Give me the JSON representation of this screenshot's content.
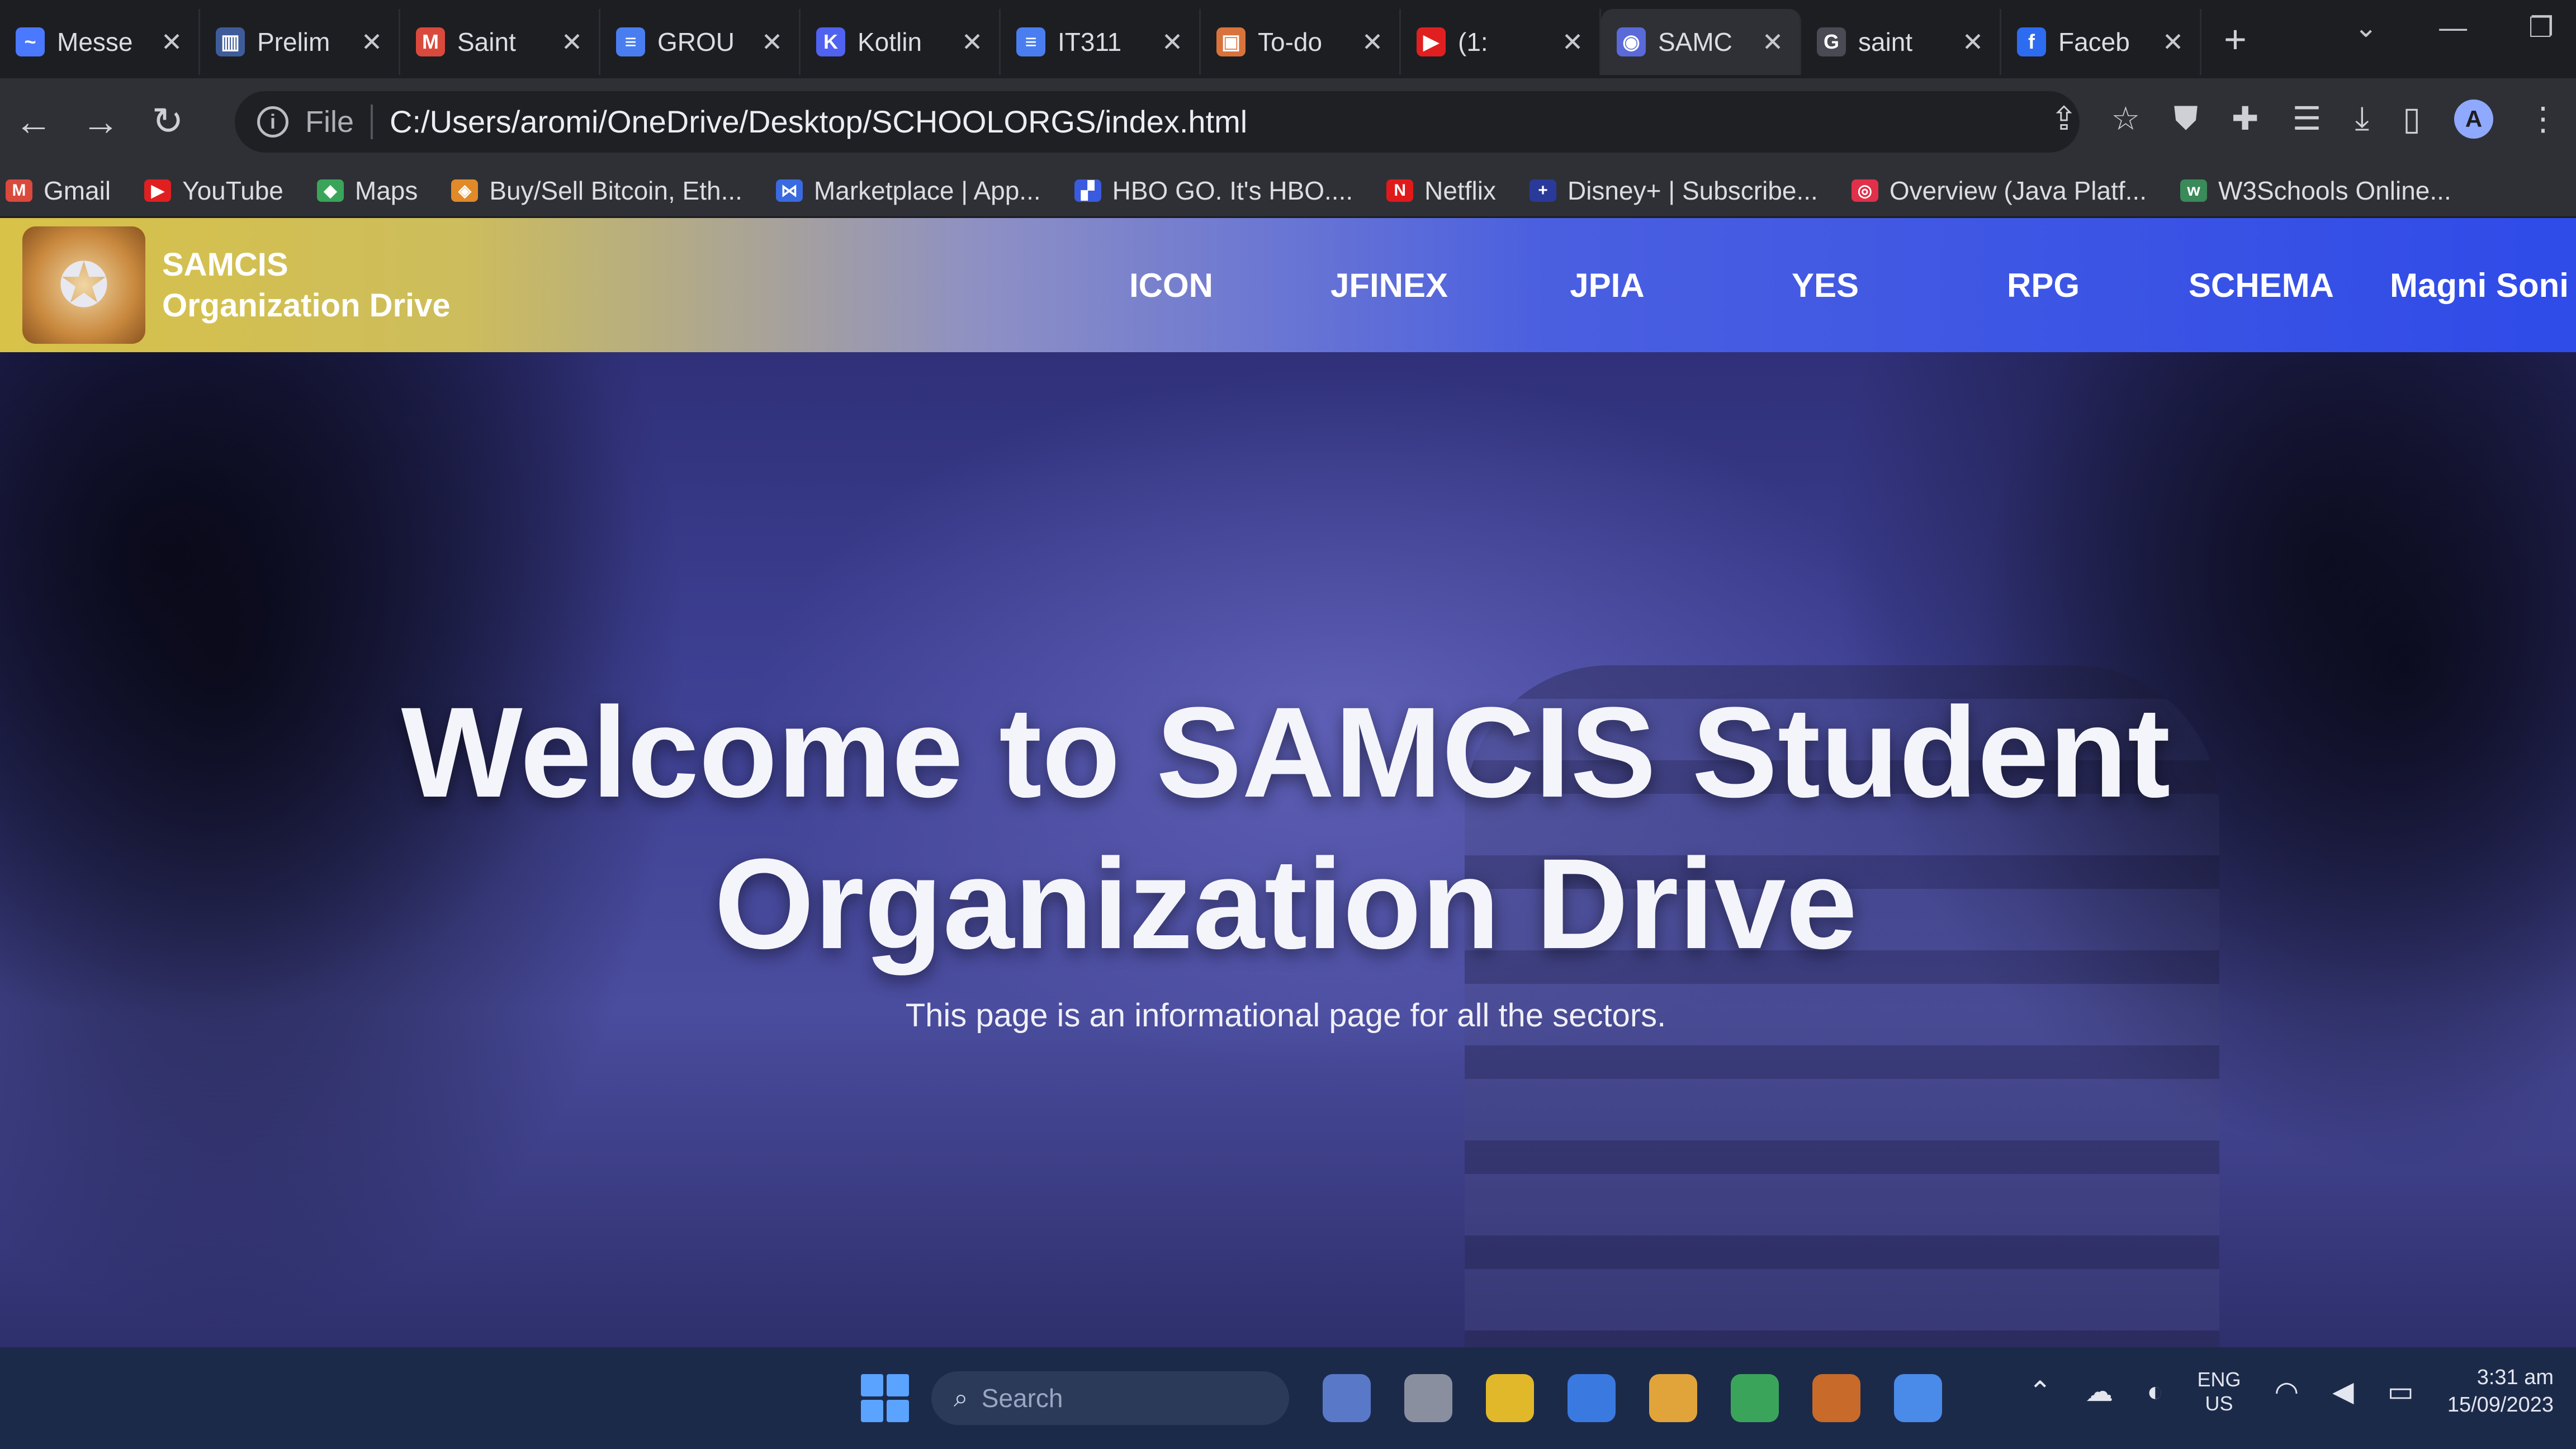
{
  "tabs": [
    {
      "title": "Messe",
      "icon": "messenger-icon",
      "color": "#4a78ff",
      "glyph": "~"
    },
    {
      "title": "Prelim",
      "icon": "trello-icon",
      "color": "#3f5c9a",
      "glyph": "▥"
    },
    {
      "title": "Saint",
      "icon": "gmail-icon",
      "color": "#d94a3c",
      "glyph": "M"
    },
    {
      "title": "GROU",
      "icon": "docs-icon",
      "color": "#4a7ef0",
      "glyph": "≡"
    },
    {
      "title": "Kotlin",
      "icon": "kotlin-icon",
      "color": "#5062f0",
      "glyph": "K"
    },
    {
      "title": "IT311",
      "icon": "docs-icon",
      "color": "#4a7ef0",
      "glyph": "≡"
    },
    {
      "title": "To-do",
      "icon": "todo-icon",
      "color": "#d9733c",
      "glyph": "▣"
    },
    {
      "title": "(1:",
      "icon": "youtube-icon",
      "color": "#e02020",
      "glyph": "▶"
    },
    {
      "title": "SAMC",
      "icon": "globe-icon",
      "color": "#5a6ad8",
      "glyph": "◉"
    },
    {
      "title": "saint",
      "icon": "google-icon",
      "color": "#4a4a55",
      "glyph": "G"
    },
    {
      "title": "Faceb",
      "icon": "facebook-icon",
      "color": "#2d6cf0",
      "glyph": "f"
    }
  ],
  "active_tab_index": 8,
  "window_controls": {
    "dropdown": "⌄",
    "minimize": "—",
    "restore": "❐"
  },
  "toolbar": {
    "back": "←",
    "forward": "→",
    "reload": "↻",
    "scheme": "File",
    "url": "C:/Users/aromi/OneDrive/Desktop/SCHOOLORGS/index.html",
    "avatar_letter": "A"
  },
  "bookmarks": [
    {
      "label": "Gmail",
      "icon": "gmail-icon",
      "color": "#d94a3c",
      "glyph": "M"
    },
    {
      "label": "YouTube",
      "icon": "youtube-icon",
      "color": "#e02020",
      "glyph": "▶"
    },
    {
      "label": "Maps",
      "icon": "maps-icon",
      "color": "#3aa55a",
      "glyph": "◆"
    },
    {
      "label": "Buy/Sell Bitcoin, Eth...",
      "icon": "exchange-icon",
      "color": "#e08a2a",
      "glyph": "◈"
    },
    {
      "label": "Marketplace | App...",
      "icon": "marketplace-icon",
      "color": "#3a6ae0",
      "glyph": "⋈"
    },
    {
      "label": "HBO GO. It's HBO....",
      "icon": "hbo-icon",
      "color": "#3a5ae0",
      "glyph": "▞"
    },
    {
      "label": "Netflix",
      "icon": "netflix-icon",
      "color": "#e01a1a",
      "glyph": "N"
    },
    {
      "label": "Disney+ | Subscribe...",
      "icon": "disney-icon",
      "color": "#2a3a9a",
      "glyph": "+"
    },
    {
      "label": "Overview (Java Platf...",
      "icon": "java-icon",
      "color": "#e0304a",
      "glyph": "◎"
    },
    {
      "label": "W3Schools Online...",
      "icon": "w3schools-icon",
      "color": "#3a8a5a",
      "glyph": "w"
    }
  ],
  "site": {
    "brand_line1": "SAMCIS",
    "brand_line2": "Organization Drive",
    "nav": [
      "ICON",
      "JFINEX",
      "JPIA",
      "YES",
      "RPG",
      "SCHEMA",
      "Magni Soni"
    ],
    "hero_title": "Welcome to SAMCIS Student Organization Drive",
    "hero_subtitle": "This page is an informational page for all the sectors."
  },
  "taskbar": {
    "search_placeholder": "Search",
    "lang_top": "ENG",
    "lang_bottom": "US",
    "time": "3:31 am",
    "date": "15/09/2023"
  },
  "colors": {
    "nav_gradient_start": "#d8c248",
    "nav_gradient_end": "#2f4be8",
    "hero_overlay": "#3d3f92"
  }
}
